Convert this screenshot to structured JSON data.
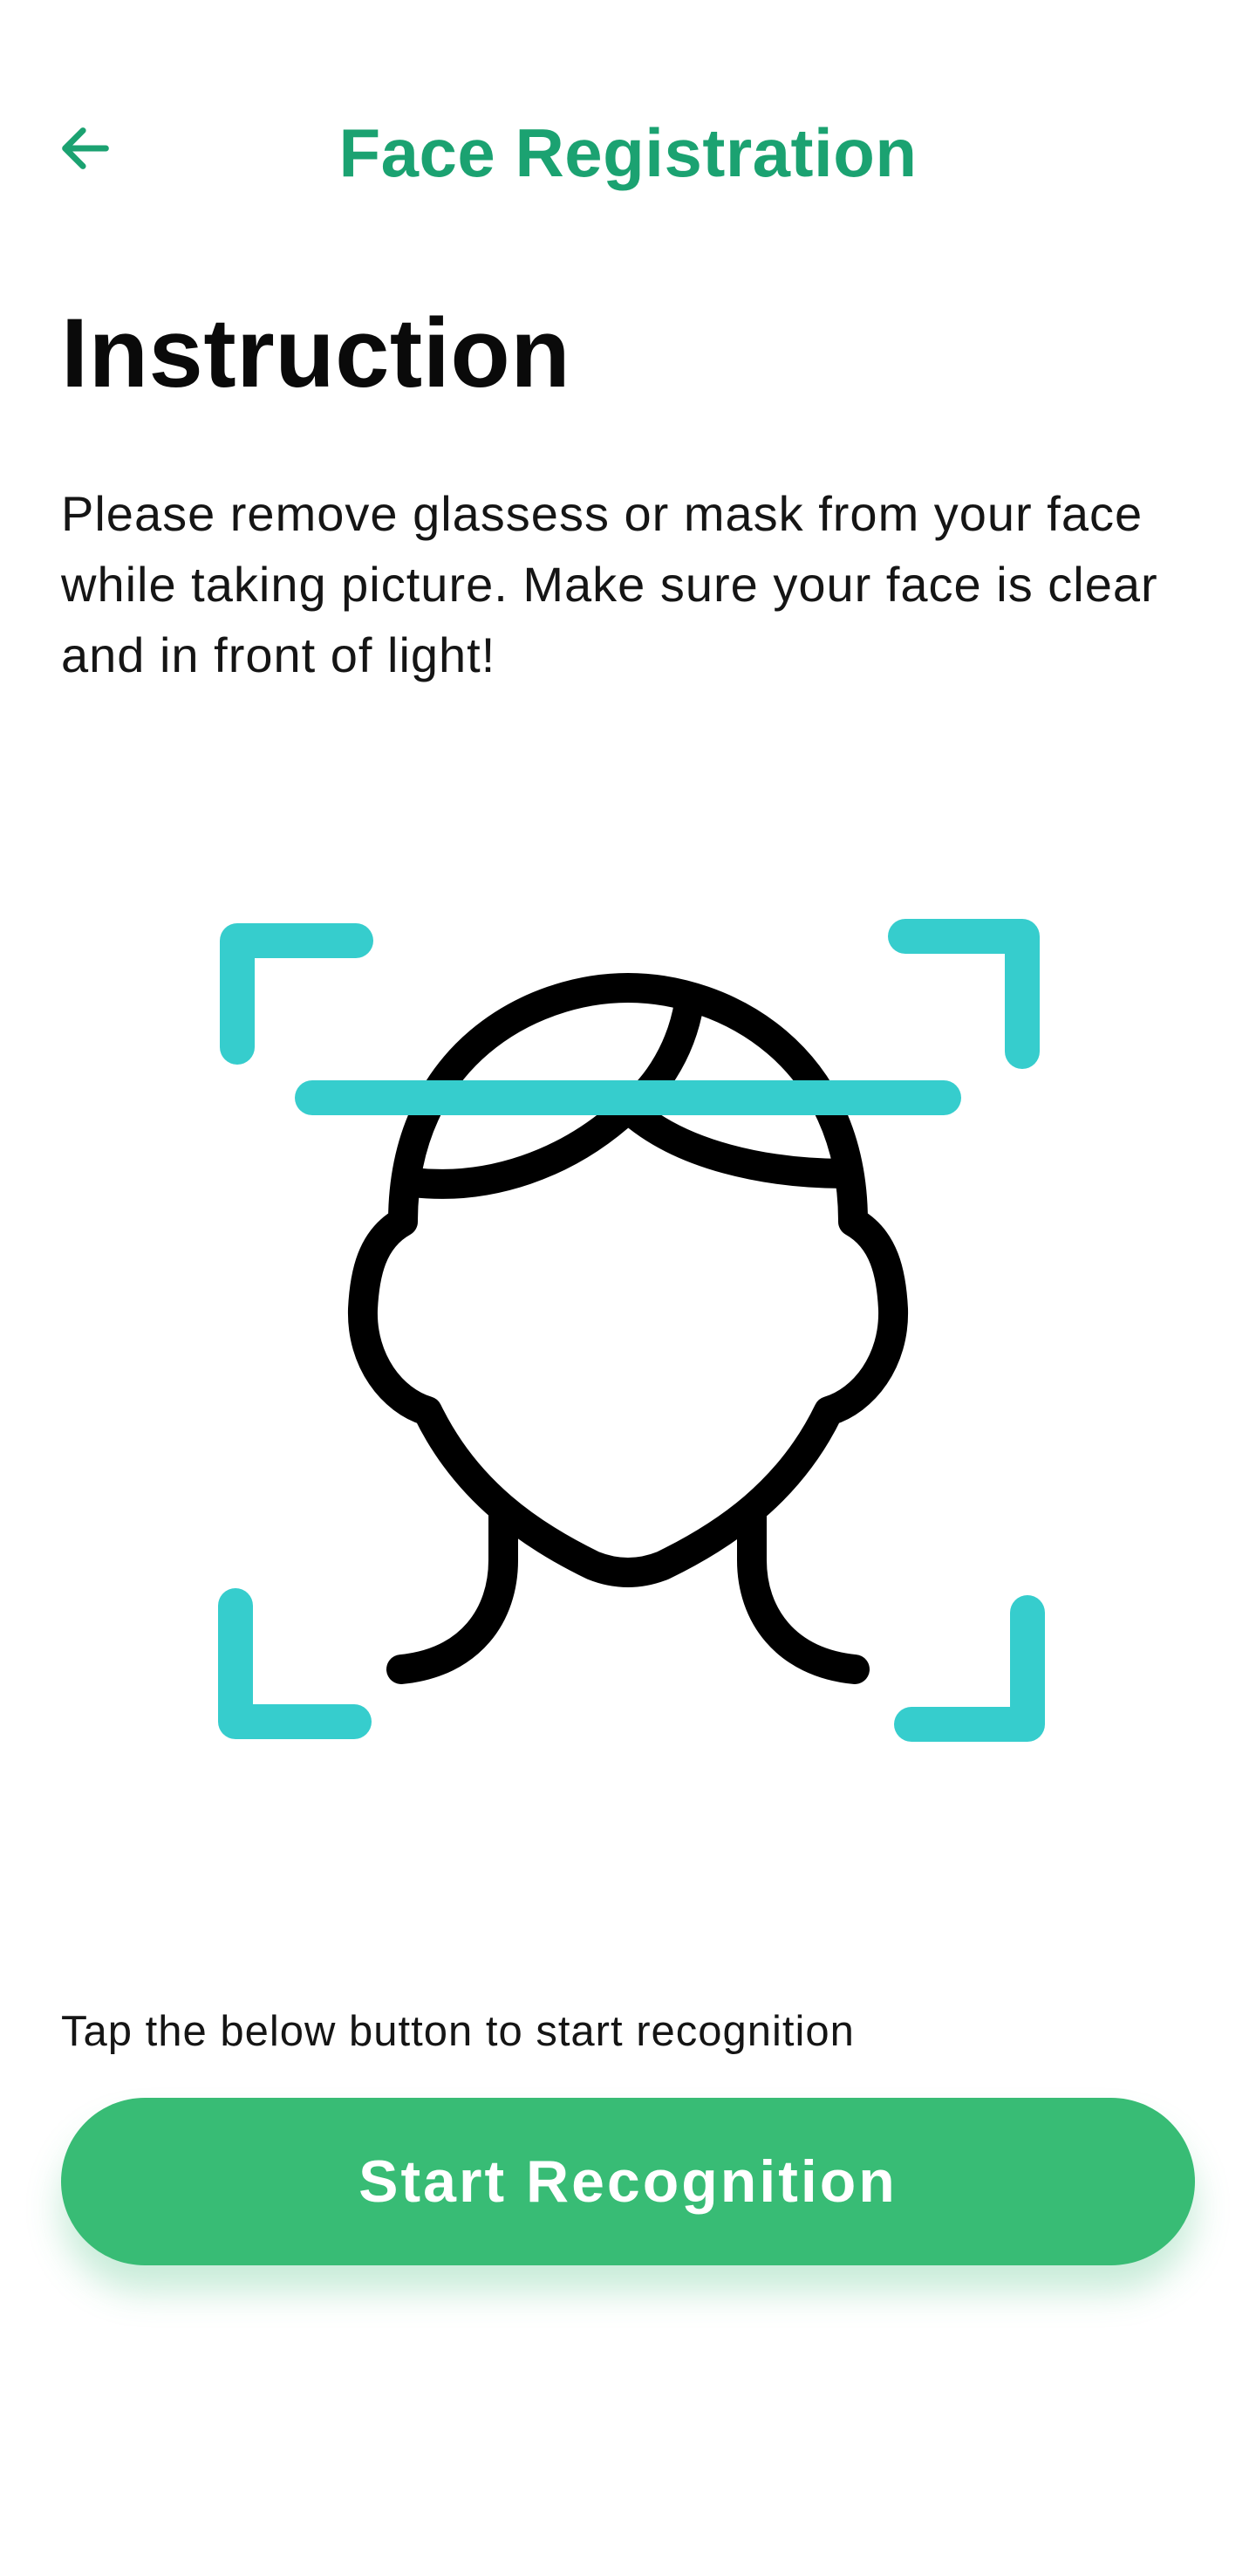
{
  "app_bar": {
    "title": "Face Registration",
    "back_icon": "arrow-left-icon",
    "accent_color": "#1ba271"
  },
  "instruction": {
    "heading": "Instruction",
    "body": "Please remove glassess or mask from your face while taking picture. Make sure your face is clear and in front of light!"
  },
  "illustration": {
    "icon": "face-scan-icon",
    "frame_color": "#36cdcd",
    "outline_color": "#000000"
  },
  "action": {
    "hint": "Tap the below button to start recognition",
    "button_label": "Start Recognition",
    "button_color": "#38bc75"
  }
}
